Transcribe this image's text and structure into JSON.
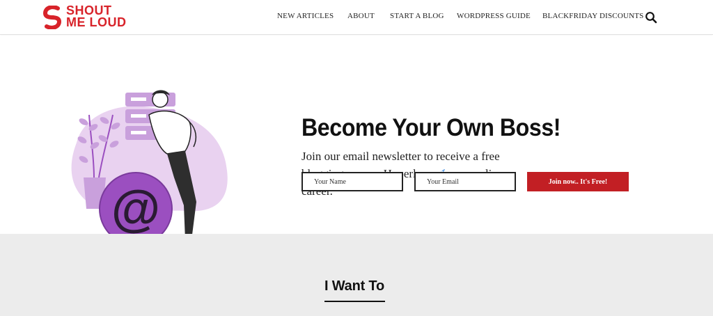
{
  "header": {
    "logo": {
      "line1": "SHOUT",
      "line2": "ME LOUD"
    },
    "nav": [
      {
        "label": "NEW ARTICLES"
      },
      {
        "label": "ABOUT"
      },
      {
        "label": "START A BLOG"
      },
      {
        "label": "WORDPRESS GUIDE"
      },
      {
        "label": "BLACKFRIDAY DISCOUNTS"
      }
    ],
    "search_icon": "search-icon"
  },
  "hero": {
    "title": "Become Your Own Boss!",
    "text_before_icon": "Join our email newsletter to receive a free blogging course. Hyperloop",
    "text_after_icon": " your online career.",
    "inline_icon": "rocket-icon",
    "name_placeholder": "Your Name",
    "email_placeholder": "Your Email",
    "join_label": "Join now.. It's Free!",
    "illustration_icon": "email-newsletter-illustration"
  },
  "section": {
    "title": "I Want To"
  },
  "colors": {
    "brand_red": "#d8232a",
    "button_red": "#c21f24",
    "illustration_purple": "#9b4fc0",
    "illustration_light": "#e7cdee",
    "band_gray": "#ececec"
  }
}
